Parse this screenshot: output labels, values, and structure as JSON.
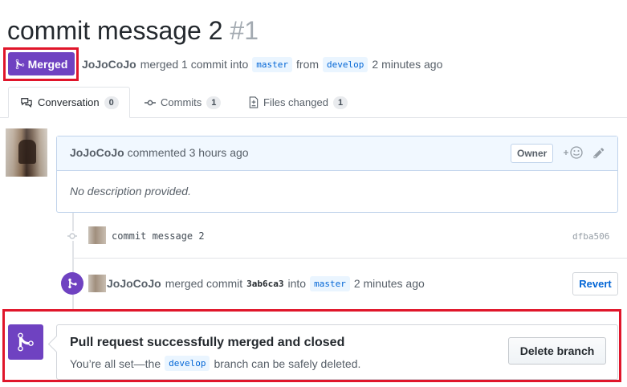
{
  "pr": {
    "title": "commit message 2",
    "number": "#1",
    "state": "Merged",
    "author": "JoJoCoJo",
    "action": "merged 1 commit into",
    "base_branch": "master",
    "from_word": "from",
    "head_branch": "develop",
    "time": "2 minutes ago"
  },
  "tabs": [
    {
      "label": "Conversation",
      "count": "0",
      "icon": "comment-discussion-icon"
    },
    {
      "label": "Commits",
      "count": "1",
      "icon": "git-commit-icon"
    },
    {
      "label": "Files changed",
      "count": "1",
      "icon": "file-diff-icon"
    }
  ],
  "comment": {
    "author": "JoJoCoJo",
    "action": "commented 3 hours ago",
    "badge": "Owner",
    "body": "No description provided."
  },
  "commit": {
    "message": "commit message 2",
    "sha": "dfba506"
  },
  "merge_event": {
    "author": "JoJoCoJo",
    "action": "merged commit",
    "sha": "3ab6ca3",
    "into": "into",
    "branch": "master",
    "time": "2 minutes ago",
    "revert_label": "Revert"
  },
  "status": {
    "title": "Pull request successfully merged and closed",
    "desc_prefix": "You’re all set—the",
    "branch": "develop",
    "desc_suffix": "branch can be safely deleted.",
    "delete_label": "Delete branch"
  },
  "colors": {
    "merged_purple": "#6f42c1",
    "highlight_red": "#e0152a",
    "link_blue": "#0366d6"
  }
}
